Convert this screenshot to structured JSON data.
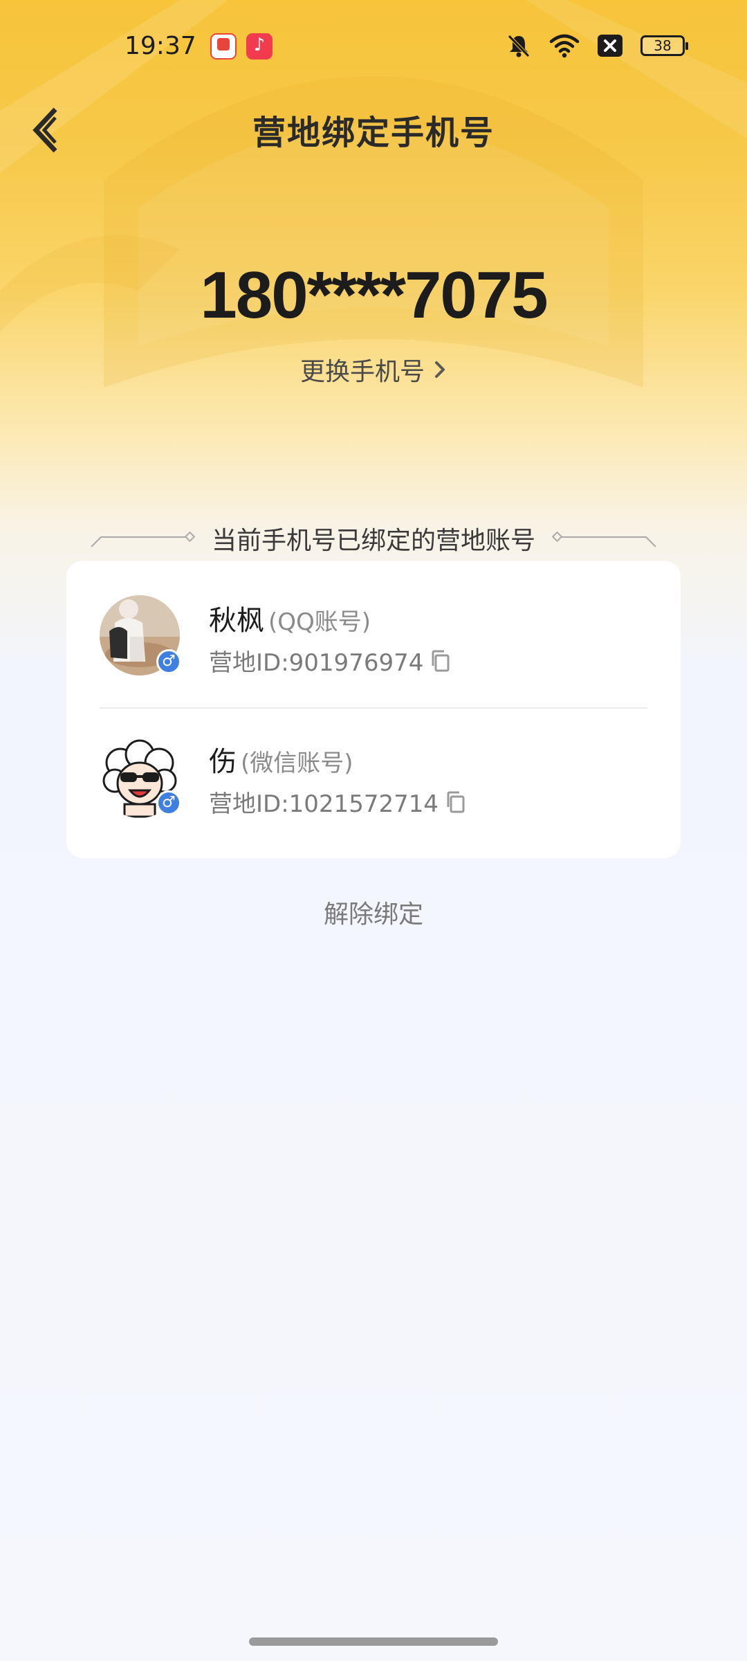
{
  "status_bar": {
    "time": "19:37",
    "battery": "38",
    "icons": [
      "app-notification-icon",
      "music-app-icon",
      "mute-icon",
      "wifi-icon",
      "close-box-icon",
      "battery-icon"
    ]
  },
  "header": {
    "title": "营地绑定手机号",
    "back_icon": "back-arrow-icon"
  },
  "phone": {
    "number": "180****7075",
    "change_label": "更换手机号"
  },
  "section": {
    "title": "当前手机号已绑定的营地账号"
  },
  "accounts": [
    {
      "name": "秋枫",
      "type": "(QQ账号)",
      "id": "营地ID:901976974",
      "gender": "♂"
    },
    {
      "name": "伤",
      "type": "(微信账号)",
      "id": "营地ID:1021572714",
      "gender": "♂"
    }
  ],
  "actions": {
    "unbind": "解除绑定"
  },
  "colors": {
    "accent_yellow": "#f7c43a",
    "gender_badge": "#3f7fe0",
    "text_primary": "#1c1c1c",
    "text_secondary": "#7a7a7a"
  }
}
